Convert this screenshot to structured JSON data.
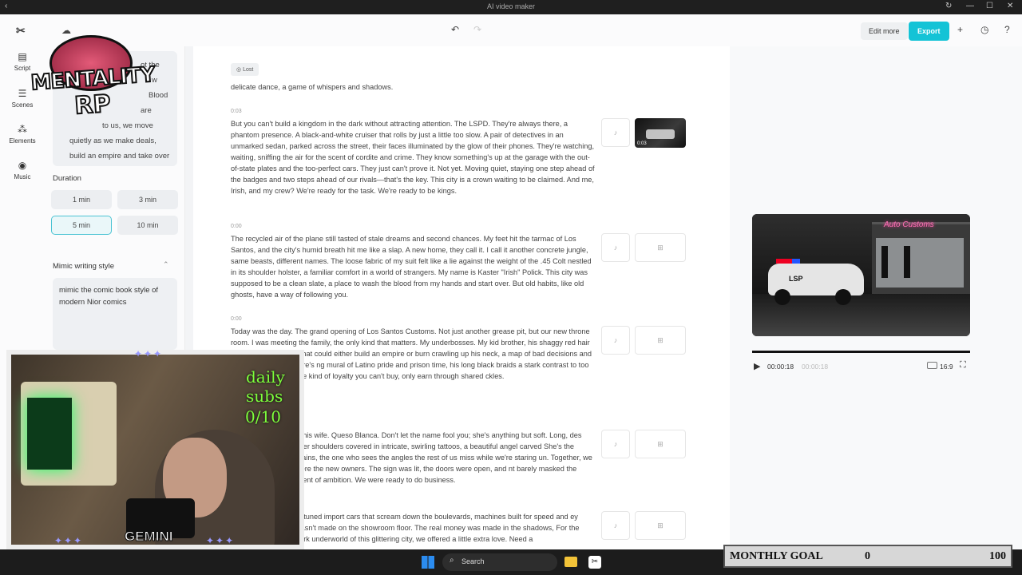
{
  "window": {
    "title": "AI video maker"
  },
  "toolbar": {
    "edit_more": "Edit more",
    "export": "Export"
  },
  "rail": {
    "items": [
      {
        "label": "Script",
        "icon": "script-icon"
      },
      {
        "label": "Scenes",
        "icon": "scenes-icon"
      },
      {
        "label": "Elements",
        "icon": "elements-icon"
      },
      {
        "label": "Music",
        "icon": "music-icon"
      }
    ]
  },
  "panel": {
    "script_lines": [
      "ot the",
      "w",
      "Blood",
      "are",
      "to us, we move",
      "quietly as we make deals,",
      "build an empire and take over"
    ],
    "duration_title": "Duration",
    "durations": [
      "1 min",
      "3 min",
      "5 min",
      "10 min"
    ],
    "selected_duration": "5 min",
    "mimic_title": "Mimic writing style",
    "mimic_text": "mimic the comic book style of modern Nior comics"
  },
  "script": {
    "tag": "Lost",
    "intro": "delicate dance, a game of whispers and shadows.",
    "scenes": [
      {
        "time": "0:03",
        "text": "But you can't build a kingdom in the dark without attracting attention. The LSPD. They're always there, a phantom presence. A black-and-white cruiser that rolls by just a little too slow. A pair of detectives in an unmarked sedan, parked across the street, their faces illuminated by the glow of their phones. They're watching, waiting, sniffing the air for the scent of cordite and crime. They know something's up at the garage with the out-of-state plates and the too-perfect cars. They just can't prove it. Not yet. Moving quiet, staying one step ahead of the badges and two steps ahead of our rivals—that's the key. This city is a crown waiting to be claimed. And me, Irish, and my crew? We're ready for the task. We're ready to be kings.",
        "thumb_time": "0:03"
      },
      {
        "time": "0:00",
        "text": "The recycled air of the plane still tasted of stale dreams and second chances. My feet hit the tarmac of Los Santos, and the city's humid breath hit me like a slap. A new home, they call it. I call it another concrete jungle, same beasts, different names. The loose fabric of my suit felt like a lie against the weight of the .45 Colt nestled in its shoulder holster, a familiar comfort in a world of strangers. My name is Kaster \"Irish\" Polick. This city was supposed to be a clean slate, a place to wash the blood from my hands and start over. But old habits, like old ghosts, have a way of following you."
      },
      {
        "time": "0:00",
        "text": "Today was the day. The grand opening of Los Santos Customs. Not just another grease pit, but our new throne room. I was meeting the family, the only kind that matters. My underbosses. My kid brother, his shaggy red hair and a fire in his eyes that could either build an empire or burn crawling up his neck, a map of bad decisions and worse fights. Then there's ng mural of Latino pride and prison time, his long black braids a stark contrast to too by his eye. He's got the kind of loyalty you can't buy, only earn through shared ckles."
      },
      {
        "time": "",
        "text": "is his wife. Queso Blanca. Don't let the name fool you; she's anything but soft. Long, des over shoulders covered in intricate, swirling tattoos, a beautiful angel carved She's the brains, the one who sees the angles the rest of us miss while we're staring un. Together, we were the new owners. The sign was lit, the doors were open, and nt barely masked the scent of ambition. We were ready to do business."
      },
      {
        "time": "",
        "text": "m tuned import cars that scream down the boulevards, machines built for speed and ey wasn't made on the showroom floor. The real money was made in the shadows, For the dark underworld of this glittering city, we offered a little extra love. Need a"
      }
    ]
  },
  "preview": {
    "sign": "Auto Customs",
    "car_text": "LSP",
    "current_time": "00:00:18",
    "total_time": "00:00:18",
    "ratio": "16:9",
    "progress": 1.0
  },
  "overlay": {
    "logo_line1": "MENTALITY",
    "logo_line2": "RP",
    "daily_subs_label": "daily subs",
    "daily_subs_value": "0/10",
    "gemini": "GEMINI"
  },
  "taskbar": {
    "search_placeholder": "Search"
  },
  "goal": {
    "label": "MONTHLY GOAL",
    "current": "0",
    "target": "100"
  }
}
